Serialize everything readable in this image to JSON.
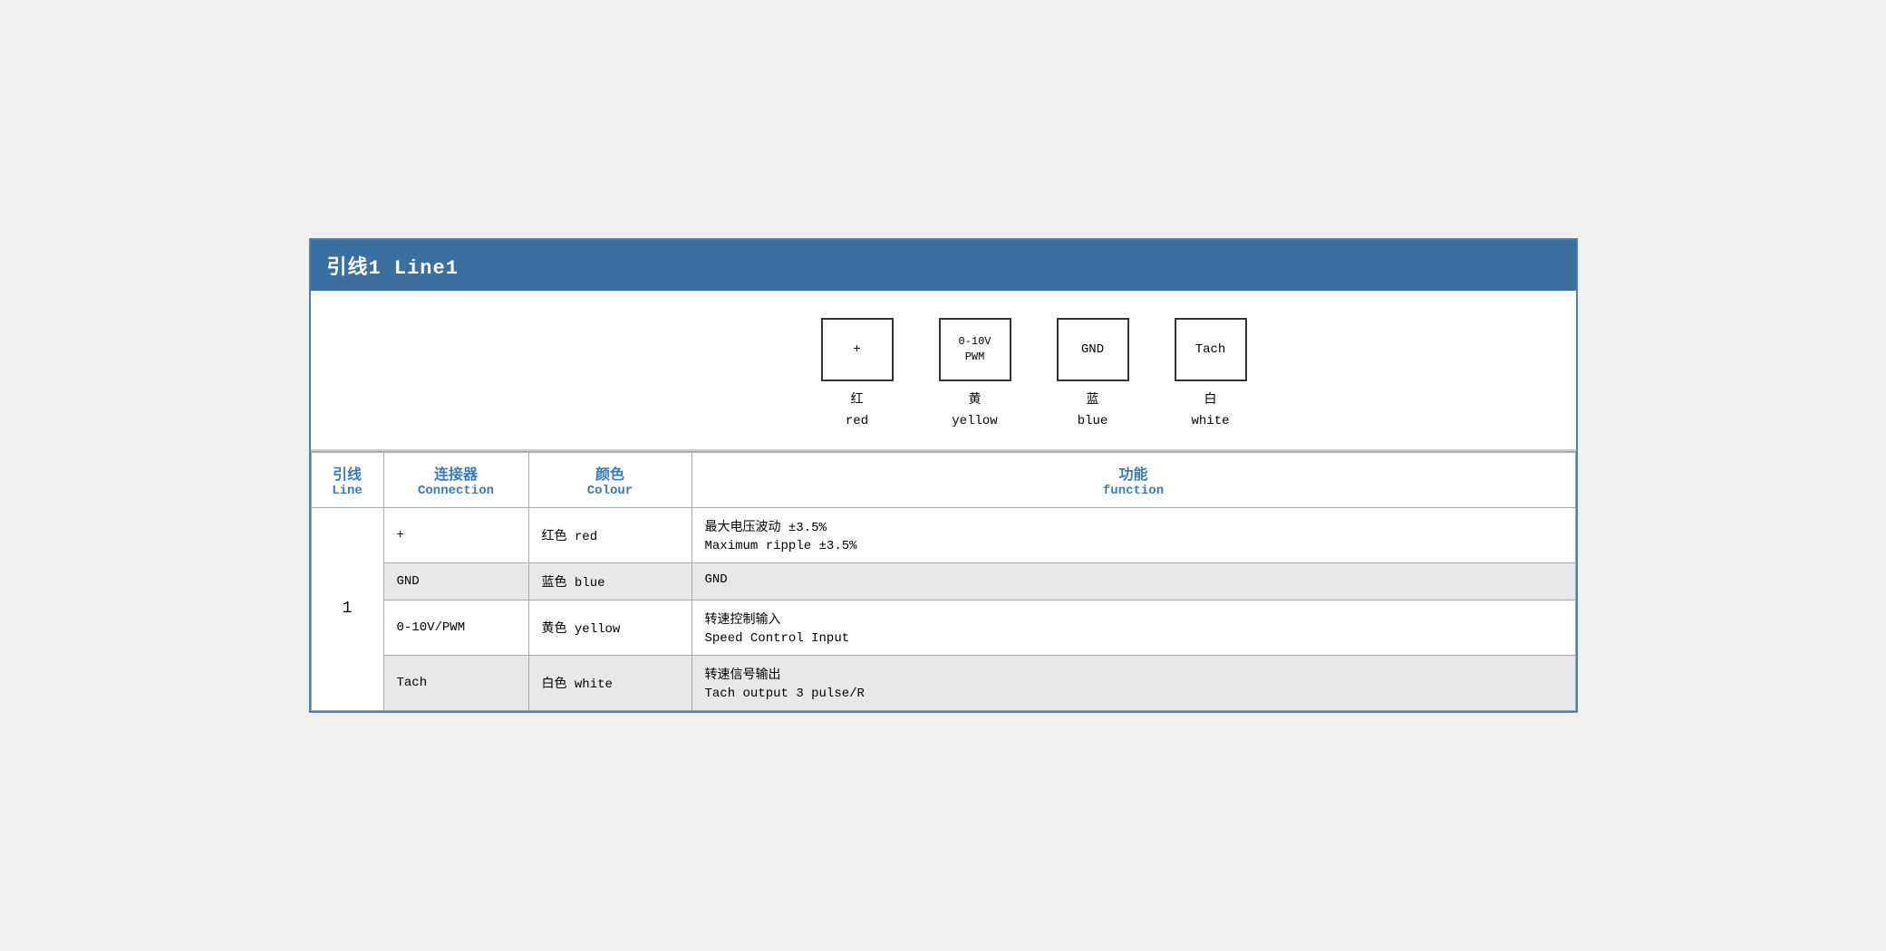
{
  "header": {
    "title": "引线1 Line1"
  },
  "diagram": {
    "connectors": [
      {
        "id": "plus",
        "label": "+",
        "chinese": "红",
        "english": "red"
      },
      {
        "id": "pwm",
        "label": "0-10V\nPWM",
        "chinese": "黄",
        "english": "yellow"
      },
      {
        "id": "gnd",
        "label": "GND",
        "chinese": "蓝",
        "english": "blue"
      },
      {
        "id": "tach",
        "label": "Tach",
        "chinese": "白",
        "english": "white"
      }
    ]
  },
  "table": {
    "headers": {
      "line_cn": "引线",
      "line_en": "Line",
      "connection_cn": "连接器",
      "connection_en": "Connection",
      "colour_cn": "颜色",
      "colour_en": "Colour",
      "function_cn": "功能",
      "function_en": "function"
    },
    "rows": [
      {
        "line": "1",
        "connection": "+",
        "colour_cn": "红色",
        "colour_en": "red",
        "function_cn": "最大电压波动 ±3.5%",
        "function_en": "Maximum ripple ±3.5%",
        "shaded": false
      },
      {
        "line": "1",
        "connection": "GND",
        "colour_cn": "蓝色",
        "colour_en": "blue",
        "function_cn": "GND",
        "function_en": "",
        "shaded": true
      },
      {
        "line": "1",
        "connection": "0-10V/PWM",
        "colour_cn": "黄色",
        "colour_en": "yellow",
        "function_cn": "转速控制输入",
        "function_en": "Speed Control Input",
        "shaded": false
      },
      {
        "line": "1",
        "connection": "Tach",
        "colour_cn": "白色",
        "colour_en": "white",
        "function_cn": "转速信号输出",
        "function_en": "Tach output 3 pulse/R",
        "shaded": true
      }
    ]
  }
}
